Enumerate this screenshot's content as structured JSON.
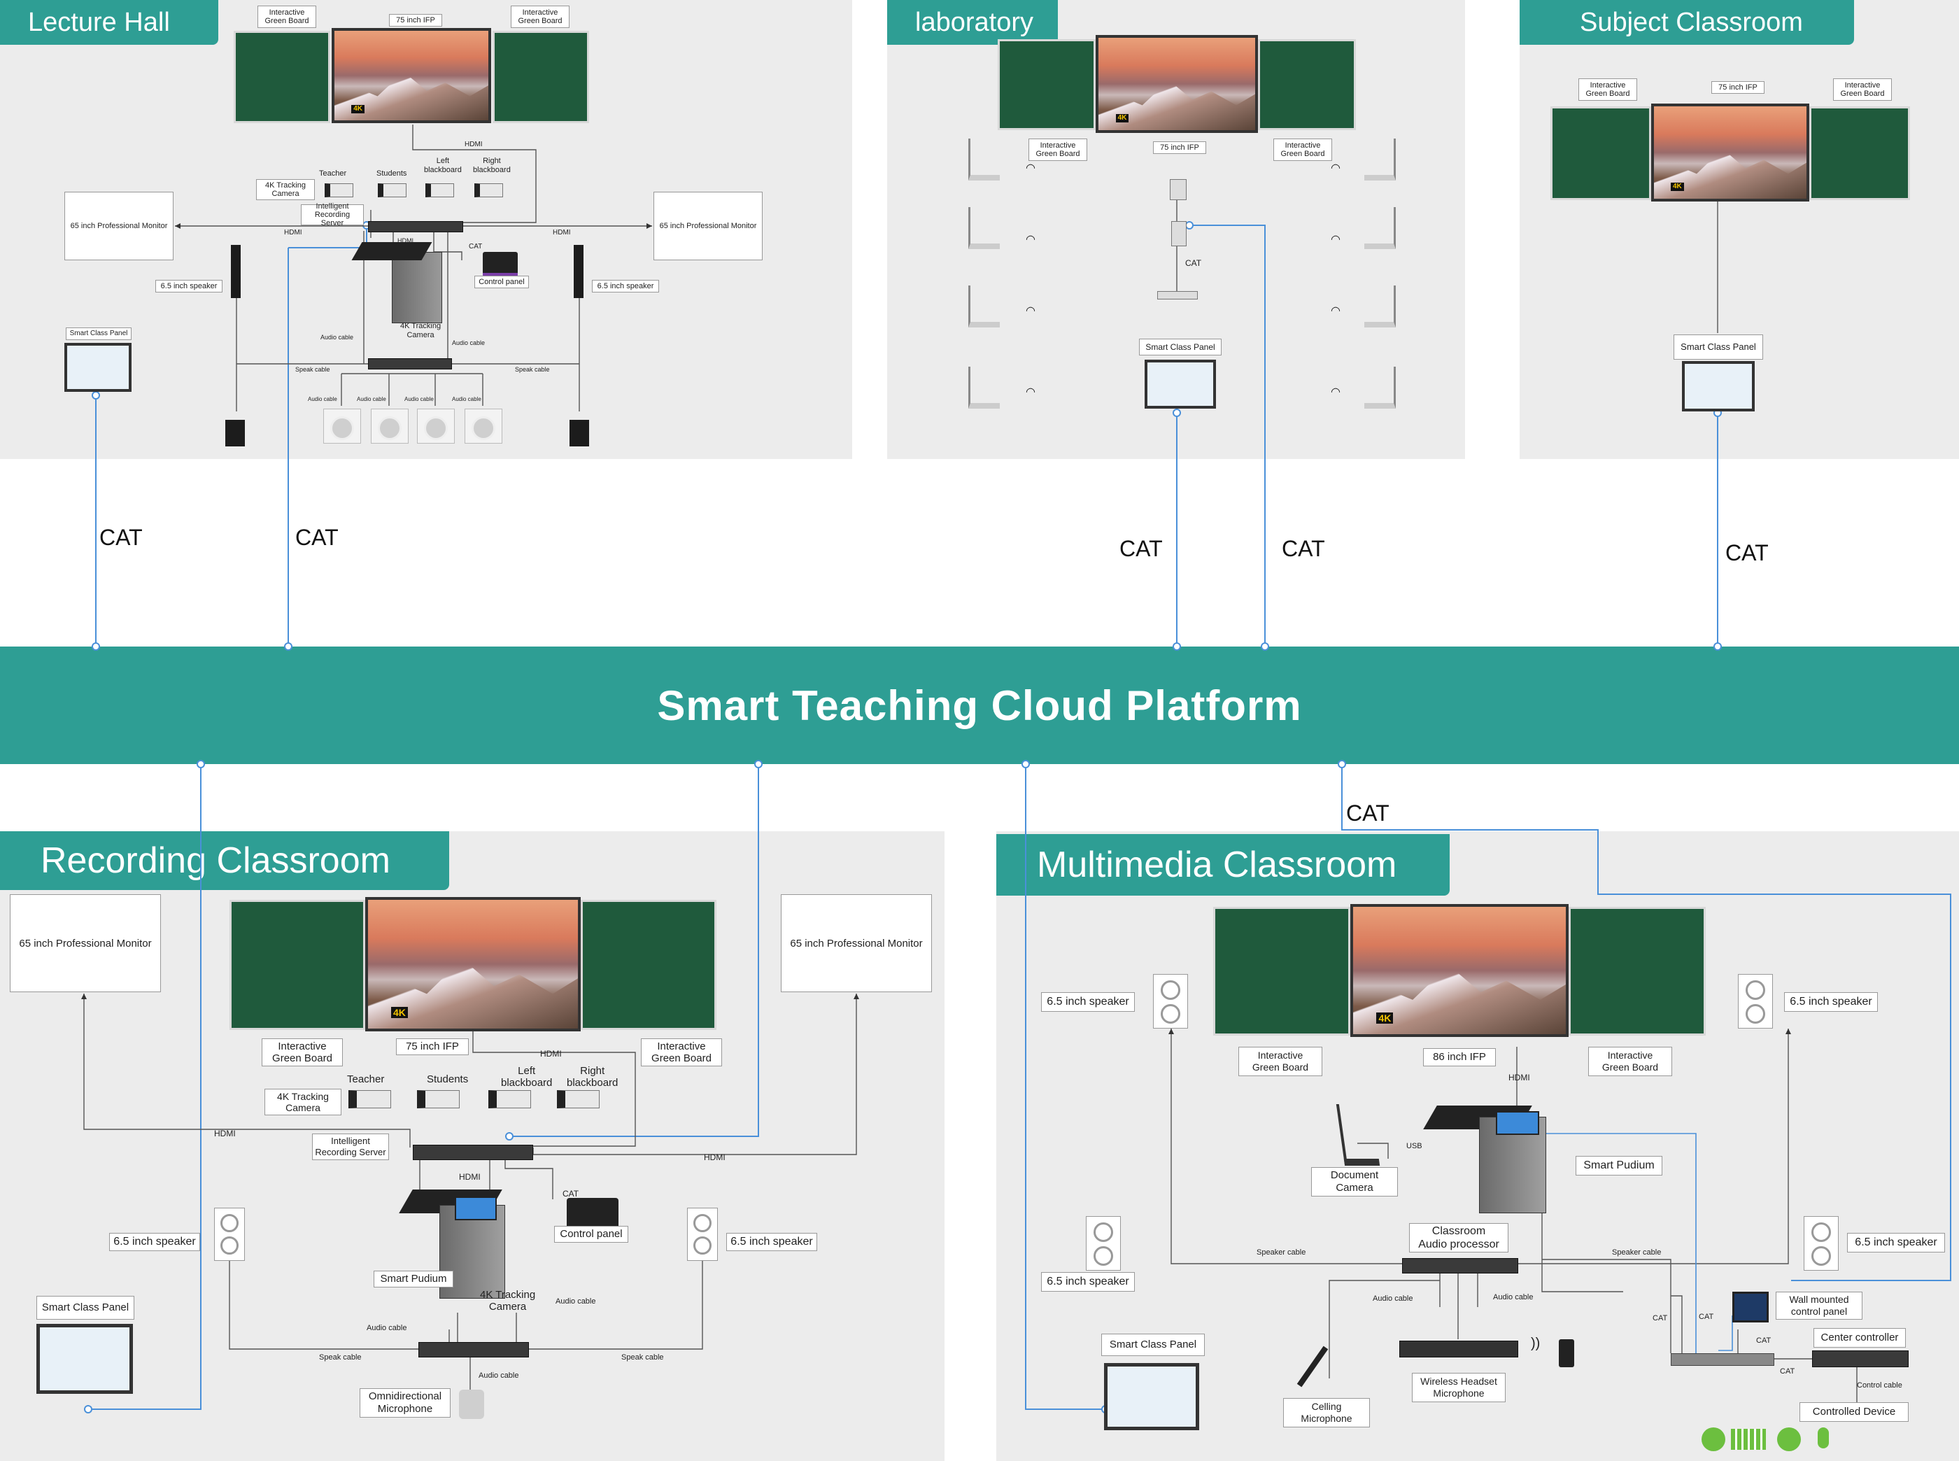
{
  "platform": {
    "title": "Smart Teaching Cloud Platform"
  },
  "colors": {
    "accent": "#2e9e94",
    "panel_bg": "#ececec",
    "link_line": "#4a90d9",
    "wire": "#555555"
  },
  "cat_labels": {
    "c1": "CAT",
    "c2": "CAT",
    "c3": "CAT",
    "c4": "CAT",
    "c5": "CAT",
    "c6": "CAT"
  },
  "lecture_hall": {
    "title": "Lecture Hall",
    "igb_left": "Interactive\nGreen Board",
    "ifp": "75 inch IFP",
    "igb_right": "Interactive\nGreen Board",
    "hdmi_top": "HDMI",
    "teacher": "Teacher",
    "students": "Students",
    "left_bb": "Left\nblackboard",
    "right_bb": "Right\nblackboard",
    "tracking_cam": "4K Tracking\nCamera",
    "rec_server": "Intelligent\nRecording Server",
    "monitor_left": "65 inch Professional Monitor",
    "monitor_right": "65 inch Professional Monitor",
    "hdmi_l": "HDMI",
    "hdmi_r": "HDMI",
    "hdmi_mid": "HDMI",
    "cat_small": "CAT",
    "control_panel": "Control panel",
    "speaker_l": "6.5 inch speaker",
    "speaker_r": "6.5 inch speaker",
    "podium_cam": "4K Tracking\nCamera",
    "audio_cable_l": "Audio cable",
    "audio_cable_r": "Audio cable",
    "speak_cable_l": "Speak cable",
    "speak_cable_r": "Speak cable",
    "smart_panel": "Smart Class Panel",
    "ac1": "Audio cable",
    "ac2": "Audio cable",
    "ac3": "Audio cable",
    "ac4": "Audio cable"
  },
  "laboratory": {
    "title": "laboratory",
    "igb_left": "Interactive\nGreen Board",
    "ifp": "75 inch IFP",
    "igb_right": "Interactive\nGreen Board",
    "cat_small": "CAT",
    "smart_panel": "Smart Class Panel"
  },
  "subject_classroom": {
    "title": "Subject Classroom",
    "igb_left": "Interactive\nGreen Board",
    "ifp": "75 inch IFP",
    "igb_right": "Interactive\nGreen Board",
    "smart_panel": "Smart Class Panel"
  },
  "recording_classroom": {
    "title": "Recording Classroom",
    "monitor_left": "65 inch Professional Monitor",
    "monitor_right": "65 inch Professional Monitor",
    "igb_left": "Interactive\nGreen Board",
    "ifp": "75 inch IFP",
    "hdmi_top": "HDMI",
    "igb_right": "Interactive\nGreen Board",
    "teacher": "Teacher",
    "students": "Students",
    "left_bb": "Left\nblackboard",
    "right_bb": "Right\nblackboard",
    "tracking_cam": "4K Tracking\nCamera",
    "hdmi_l": "HDMI",
    "hdmi_r": "HDMI",
    "rec_server": "Intelligent\nRecording Server",
    "hdmi_mid": "HDMI",
    "cat_small": "CAT",
    "control_panel": "Control panel",
    "speaker_l": "6.5 inch speaker",
    "speaker_r": "6.5 inch speaker",
    "smart_podium": "Smart Pudium",
    "podium_cam": "4K Tracking\nCamera",
    "audio_cable_l": "Audio cable",
    "audio_cable_r": "Audio cable",
    "speak_cable_l": "Speak cable",
    "speak_cable_r": "Speak cable",
    "smart_panel": "Smart Class Panel",
    "audio_cable_b": "Audio cable",
    "omni_mic": "Omnidirectional\nMicrophone"
  },
  "multimedia_classroom": {
    "title": "Multimedia Classroom",
    "speaker_tl": "6.5 inch speaker",
    "speaker_tr": "6.5 inch speaker",
    "igb_left": "Interactive\nGreen Board",
    "ifp": "86 inch IFP",
    "igb_right": "Interactive\nGreen Board",
    "hdmi": "HDMI",
    "usb": "USB",
    "doc_cam": "Document\nCamera",
    "smart_podium": "Smart Pudium",
    "audio_proc": "Classroom\nAudio processor",
    "speak_cable_l": "Speaker cable",
    "speak_cable_r": "Speaker cable",
    "speaker_bl": "6.5 inch speaker",
    "speaker_br": "6.5 inch speaker",
    "audio_cable_l": "Audio cable",
    "audio_cable_r": "Audio cable",
    "cat_a": "CAT",
    "cat_b": "CAT",
    "wall_panel": "Wall mounted\ncontrol panel",
    "cat_c": "CAT",
    "center_ctrl": "Center controller",
    "cat_d": "CAT",
    "control_cable": "Control cable",
    "controlled_dev": "Controlled Device",
    "smart_panel": "Smart Class Panel",
    "ceiling_mic": "Celling\nMicrophone",
    "wireless_mic": "Wireless Headset\nMicrophone"
  }
}
